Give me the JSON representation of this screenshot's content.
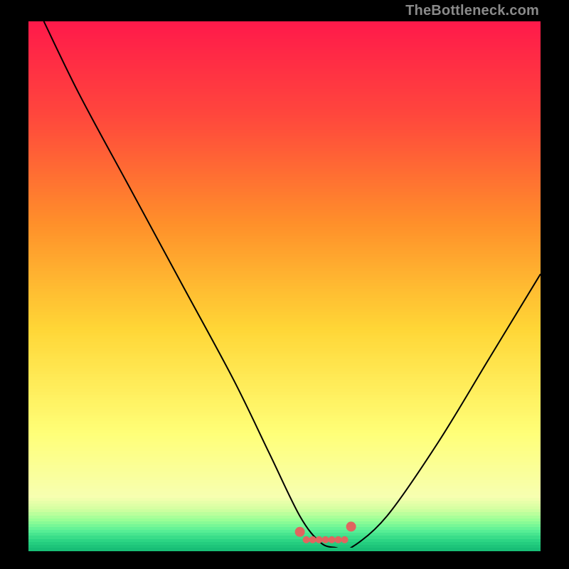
{
  "watermark": "TheBottleneck.com",
  "colors": {
    "black": "#000000",
    "watermark": "#8a8a8a",
    "curve": "#000000",
    "dots": "#e0655f",
    "gradient_top": "#ff1a4a",
    "gradient_mid1": "#ff8f2a",
    "gradient_mid2": "#ffe63a",
    "gradient_low": "#f7ffb0",
    "green1": "#b6ff8c",
    "green2": "#66ff99",
    "green3": "#2ee88a",
    "green4": "#18c97a"
  },
  "chart_data": {
    "type": "line",
    "title": "",
    "xlabel": "",
    "ylabel": "",
    "xlim": [
      0,
      100
    ],
    "ylim": [
      0,
      100
    ],
    "x": [
      3,
      10,
      20,
      30,
      40,
      47,
      53,
      57,
      60,
      63,
      70,
      80,
      90,
      100
    ],
    "values": [
      100,
      86,
      68,
      50,
      32,
      18,
      6,
      1,
      0,
      0,
      6,
      20,
      36,
      52
    ],
    "plateau_x": [
      53,
      63
    ],
    "plateau_y": 1.5,
    "annotations": [],
    "notes": "V-shaped bottleneck curve with flat minimum around x≈53–63. Background is a vertical red→orange→yellow→pale→green gradient (green only in bottom ~6%)."
  }
}
